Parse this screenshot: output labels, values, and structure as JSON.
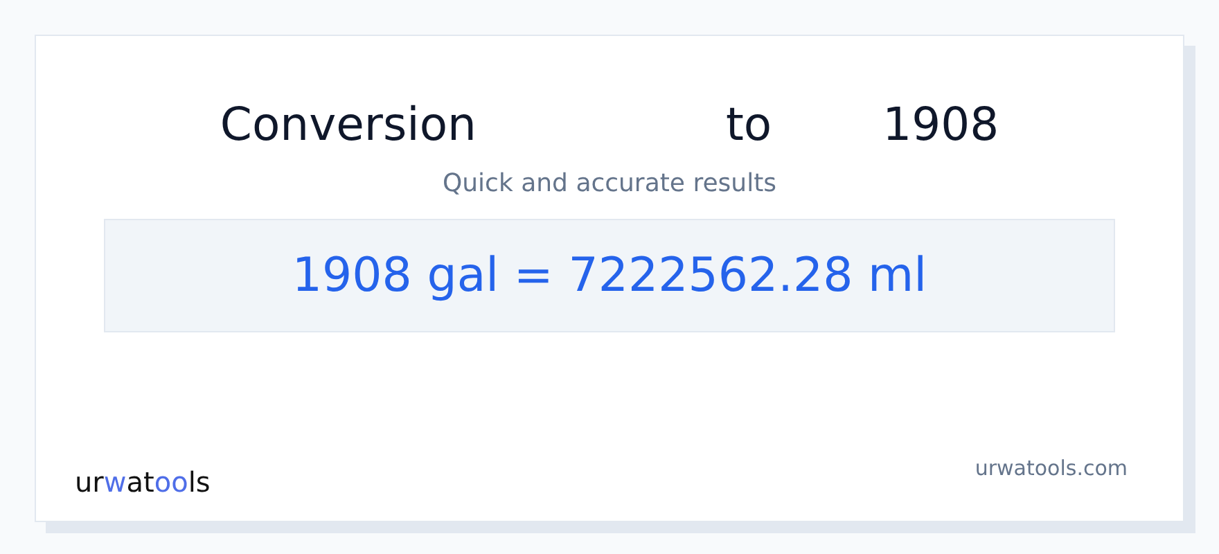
{
  "heading": [
    "Conversion",
    "to",
    "1908"
  ],
  "subtitle": "Quick and accurate results",
  "result": "1908 gal = 7222562.28 ml",
  "logo": [
    {
      "text": "ur",
      "accent": false
    },
    {
      "text": "w",
      "accent": true
    },
    {
      "text": "at",
      "accent": false
    },
    {
      "text": "oo",
      "accent": true
    },
    {
      "text": "ls",
      "accent": false
    }
  ],
  "site": "urwatools.com"
}
